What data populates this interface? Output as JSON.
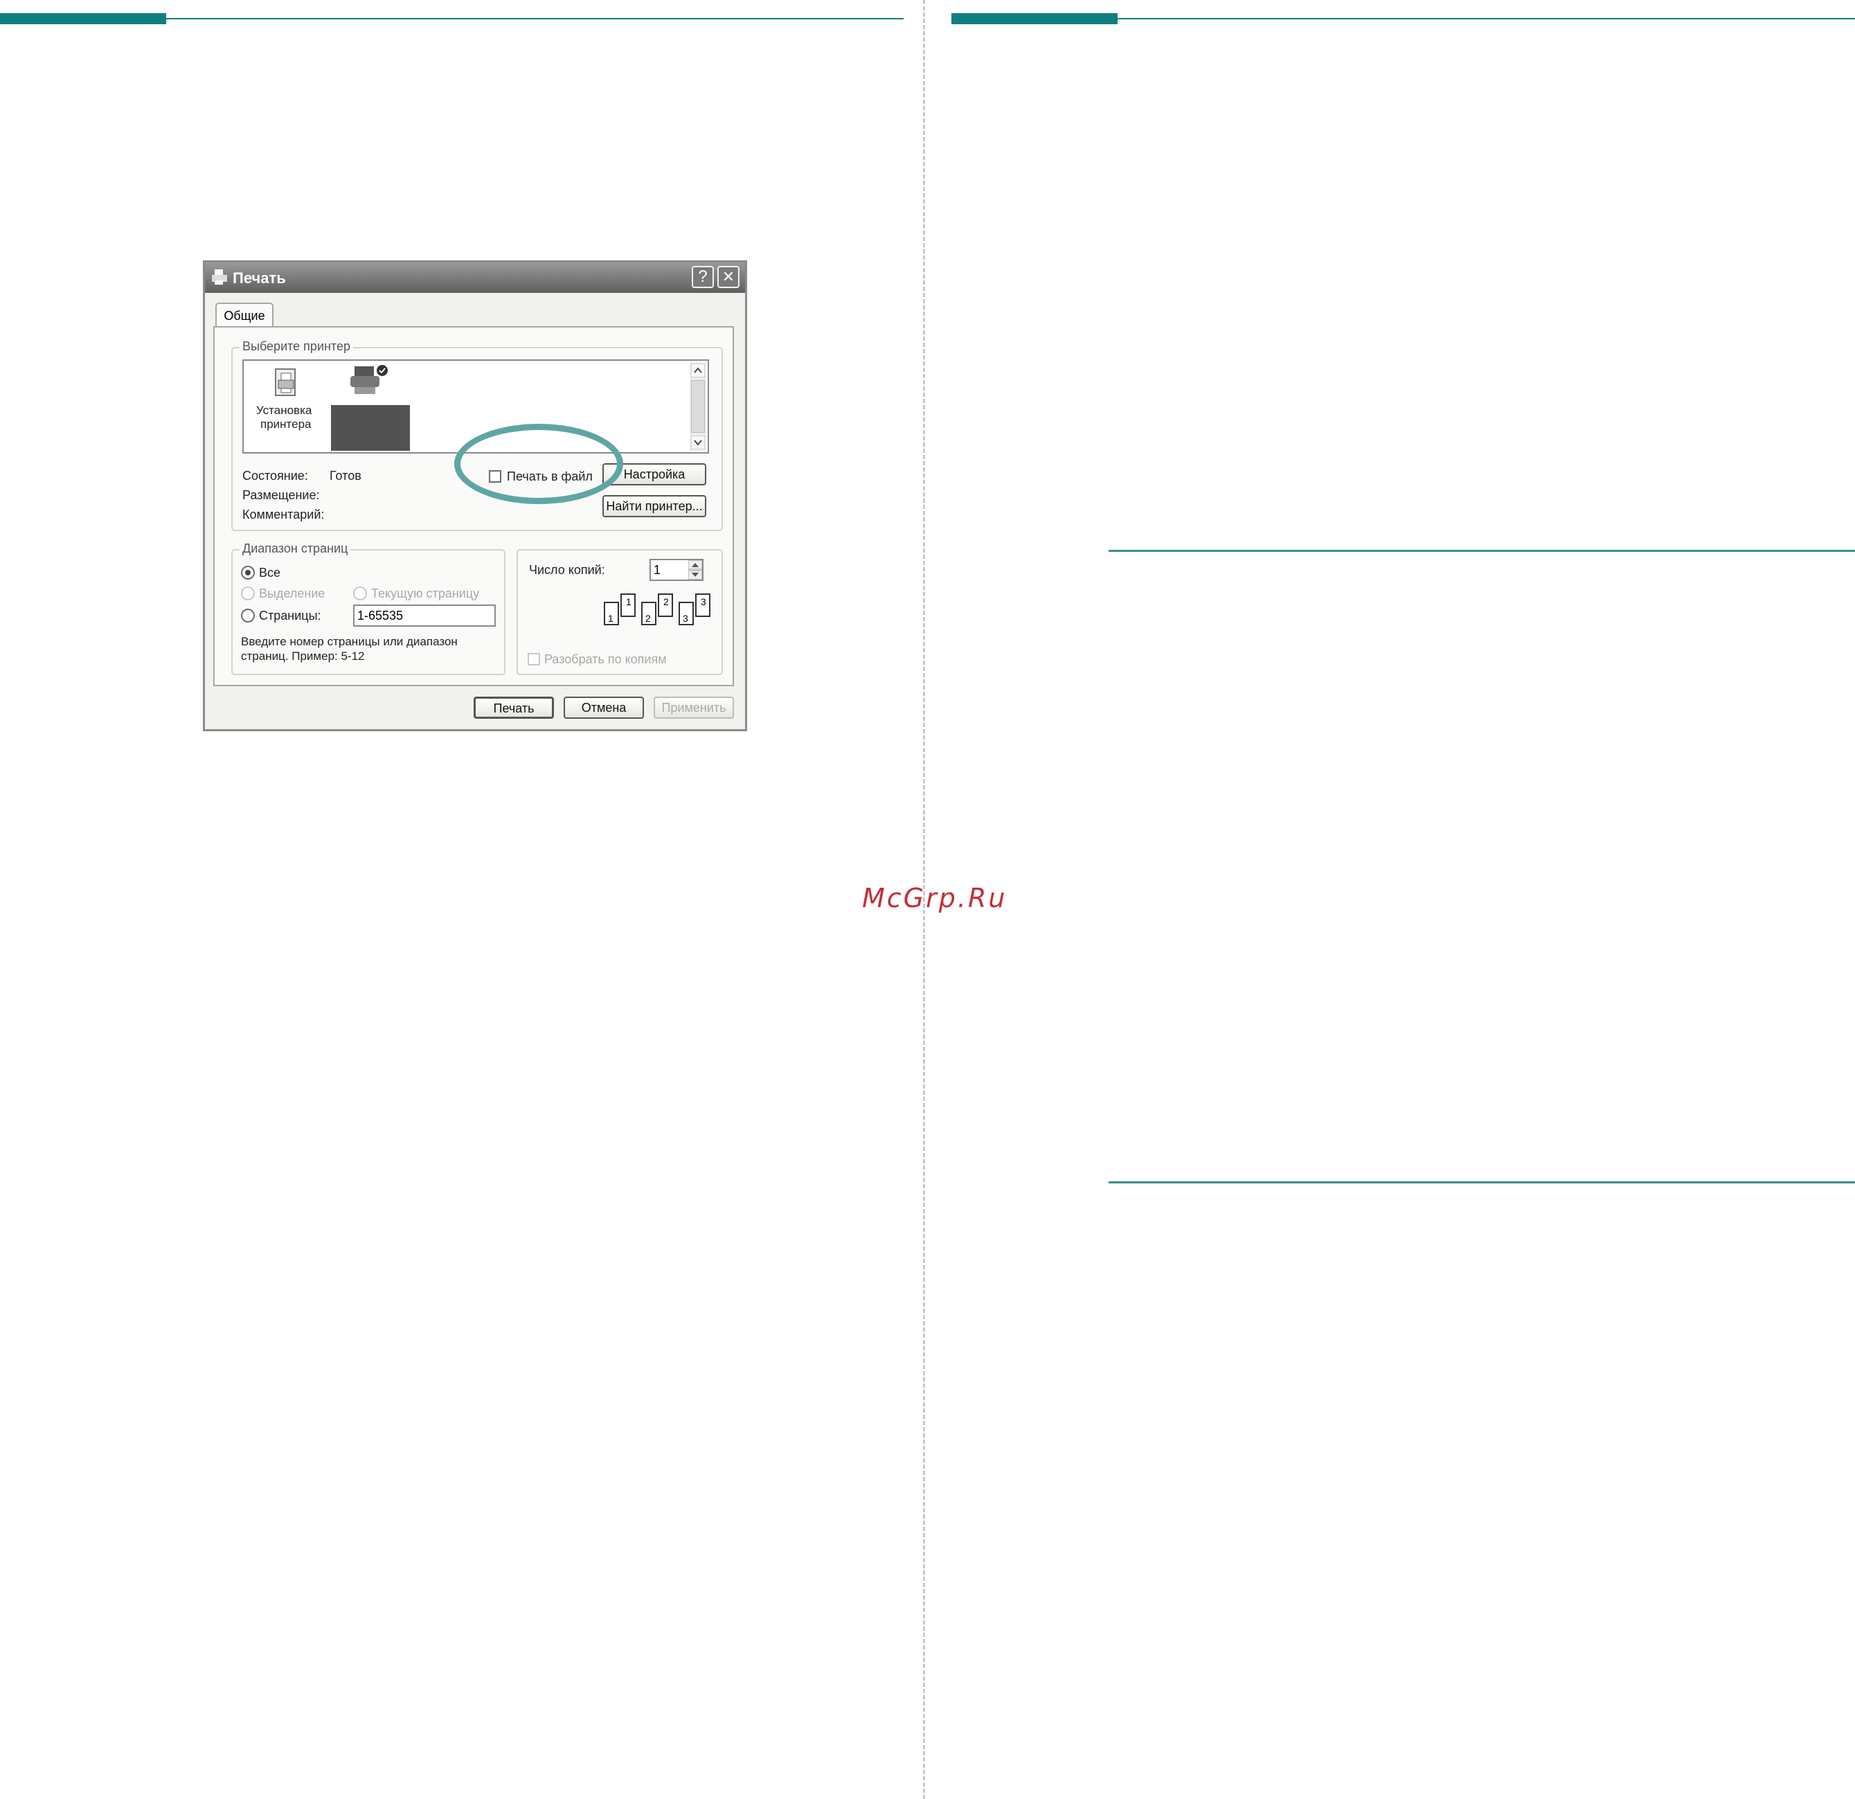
{
  "watermark": "McGrp.Ru",
  "dialog": {
    "title": "Печать",
    "help_button": "?",
    "close_button": "✕",
    "tab_general": "Общие",
    "select_printer": {
      "legend": "Выберите принтер",
      "add_printer_line1": "Установка",
      "add_printer_line2": "принтера"
    },
    "status_label": "Состояние:",
    "status_value": "Готов",
    "location_label": "Размещение:",
    "comment_label": "Комментарий:",
    "print_to_file": "Печать в файл",
    "preferences_button": "Настройка",
    "find_printer_button": "Найти принтер...",
    "page_range": {
      "legend": "Диапазон страниц",
      "all": "Все",
      "selection": "Выделение",
      "current_page": "Текущую страницу",
      "pages": "Страницы:",
      "pages_value": "1-65535",
      "hint_line1": "Введите номер страницы или диапазон",
      "hint_line2": "страниц.  Пример: 5-12"
    },
    "copies_label": "Число копий:",
    "copies_value": "1",
    "collate": "Разобрать по копиям",
    "collate_digits": [
      "1",
      "1",
      "2",
      "2",
      "3",
      "3"
    ],
    "print_button": "Печать",
    "cancel_button": "Отмена",
    "apply_button": "Применить"
  },
  "colors": {
    "accent_teal": "#107f7f",
    "highlight_ring": "#5fa6a3",
    "watermark": "#c0303a"
  }
}
